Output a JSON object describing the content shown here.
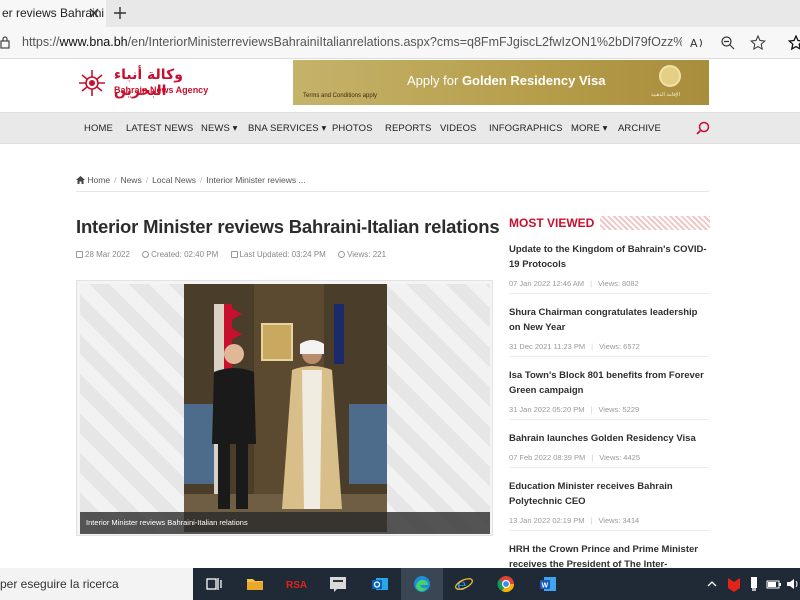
{
  "browser": {
    "tab_title": "er reviews Bahraini",
    "url_prefix": "https://",
    "url_domain": "www.bna.bh",
    "url_rest": "/en/InteriorMinisterreviewsBahrainiItalianrelations.aspx?cms=q8FmFJgiscL2fwIzON1%2bDl79fOzz%2fL%2f..."
  },
  "header": {
    "logo_ar": "وكالة أنباء البحرين",
    "logo_en": "Bahrain News Agency",
    "banner_text_prefix": "Apply for",
    "banner_text_bold": "Golden Residency Visa",
    "banner_small": "Terms and Conditions apply",
    "banner_emblem_label": "الإقامة الذهبية"
  },
  "nav": {
    "items": [
      "HOME",
      "LATEST NEWS",
      "NEWS ▾",
      "BNA SERVICES ▾",
      "PHOTOS",
      "REPORTS",
      "VIDEOS",
      "INFOGRAPHICS",
      "MORE ▾",
      "ARCHIVE"
    ]
  },
  "breadcrumb": [
    "Home",
    "News",
    "Local News",
    "Interior Minister reviews ..."
  ],
  "article": {
    "title": "Interior Minister reviews Bahraini-Italian relations",
    "date": "28 Mar 2022",
    "created": "Created: 02:40 PM",
    "updated": "Last Updated: 03:24 PM",
    "views": "Views: 221",
    "caption": "Interior Minister reviews Bahraini-Italian relations"
  },
  "most_viewed": {
    "title": "MOST VIEWED",
    "items": [
      {
        "title": "Update to the Kingdom of Bahrain's COVID-19 Protocols",
        "date": "07 Jan 2022 12:46 AM",
        "views": "Views: 8082"
      },
      {
        "title": "Shura Chairman congratulates leadership on New Year",
        "date": "31 Dec 2021 11:23 PM",
        "views": "Views: 6572"
      },
      {
        "title": "Isa Town's Block 801 benefits from Forever Green campaign",
        "date": "31 Jan 2022 05:20 PM",
        "views": "Views: 5229"
      },
      {
        "title": "Bahrain launches Golden Residency Visa",
        "date": "07 Feb 2022 08:39 PM",
        "views": "Views: 4425"
      },
      {
        "title": "Education Minister receives Bahrain Polytechnic CEO",
        "date": "13 Jan 2022 02:19 PM",
        "views": "Views: 3414"
      },
      {
        "title": "HRH the Crown Prince and Prime Minister receives the President of The Inter-",
        "date": "",
        "views": ""
      }
    ]
  },
  "taskbar": {
    "search_text": "per eseguire la ricerca",
    "rsa_label": "RSA"
  },
  "colors": {
    "brand_red": "#c8102e",
    "nav_bg": "#e9e9e9",
    "taskbar_bg": "#1f2a36"
  }
}
